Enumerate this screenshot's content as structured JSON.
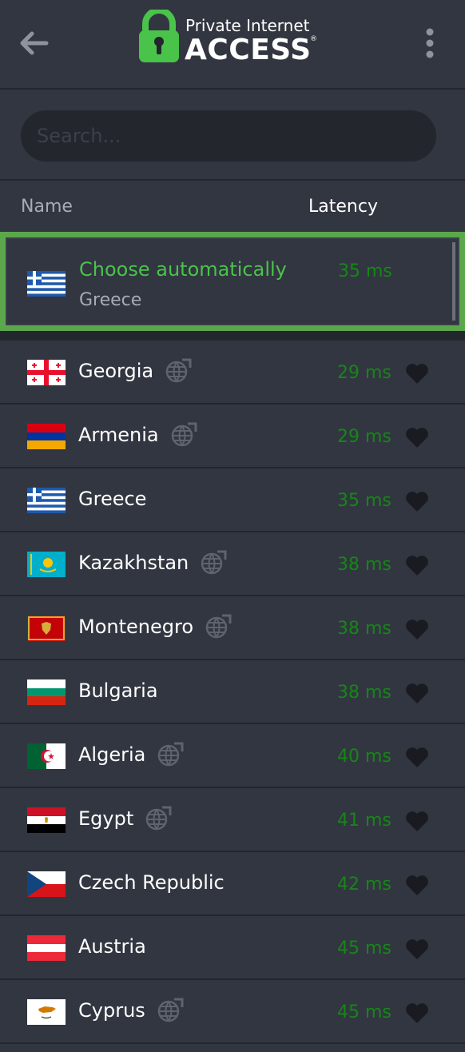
{
  "header": {
    "logo_line1": "Private Internet",
    "logo_line2": "ACCESS",
    "logo_reg": "®"
  },
  "search": {
    "placeholder": "Search...",
    "value": ""
  },
  "columns": {
    "name": "Name",
    "latency": "Latency"
  },
  "auto": {
    "title": "Choose automatically",
    "subtitle": "Greece",
    "latency": "35 ms",
    "flag": "greece"
  },
  "colors": {
    "accent_green": "#5ba84c",
    "latency_green": "#158715",
    "background": "#323641",
    "divider": "#23262d"
  },
  "regions": [
    {
      "name": "Georgia",
      "latency": "29 ms",
      "geo": true,
      "flag": "georgia"
    },
    {
      "name": "Armenia",
      "latency": "29 ms",
      "geo": true,
      "flag": "armenia"
    },
    {
      "name": "Greece",
      "latency": "35 ms",
      "geo": false,
      "flag": "greece"
    },
    {
      "name": "Kazakhstan",
      "latency": "38 ms",
      "geo": true,
      "flag": "kazakhstan"
    },
    {
      "name": "Montenegro",
      "latency": "38 ms",
      "geo": true,
      "flag": "montenegro"
    },
    {
      "name": "Bulgaria",
      "latency": "38 ms",
      "geo": false,
      "flag": "bulgaria"
    },
    {
      "name": "Algeria",
      "latency": "40 ms",
      "geo": true,
      "flag": "algeria"
    },
    {
      "name": "Egypt",
      "latency": "41 ms",
      "geo": true,
      "flag": "egypt"
    },
    {
      "name": "Czech Republic",
      "latency": "42 ms",
      "geo": false,
      "flag": "czech"
    },
    {
      "name": "Austria",
      "latency": "45 ms",
      "geo": false,
      "flag": "austria"
    },
    {
      "name": "Cyprus",
      "latency": "45 ms",
      "geo": true,
      "flag": "cyprus"
    }
  ],
  "icons": {
    "back": "back-arrow-icon",
    "menu": "more-vertical-icon",
    "geo": "geo-location-globe-icon",
    "favorite": "heart-icon"
  }
}
